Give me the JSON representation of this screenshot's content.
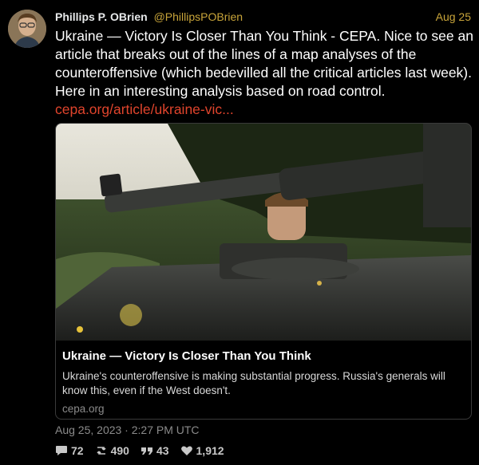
{
  "author": {
    "name": "Phillips P. OBrien",
    "handle": "@PhillipsPOBrien",
    "date": "Aug 25"
  },
  "tweet": {
    "text": "Ukraine — Victory Is Closer Than You Think - CEPA. Nice to see an article that breaks out of the lines of a map analyses of the counteroffensive (which bedevilled all the critical articles last week). Here in an interesting analysis based on road control.",
    "link": "cepa.org/article/ukraine-vic..."
  },
  "card": {
    "title": "Ukraine — Victory Is Closer Than You Think",
    "description": "Ukraine's counteroffensive is making substantial progress. Russia's generals will know this, even if the West doesn't.",
    "domain": "cepa.org"
  },
  "timestamp": "Aug 25, 2023 · 2:27 PM UTC",
  "stats": {
    "replies": "72",
    "retweets": "490",
    "quotes": "43",
    "likes": "1,912"
  },
  "colors": {
    "handle": "#c9a53a",
    "link": "#e0442c",
    "background": "#000000"
  },
  "icons": [
    "reply-icon",
    "retweet-icon",
    "quote-icon",
    "heart-icon"
  ]
}
